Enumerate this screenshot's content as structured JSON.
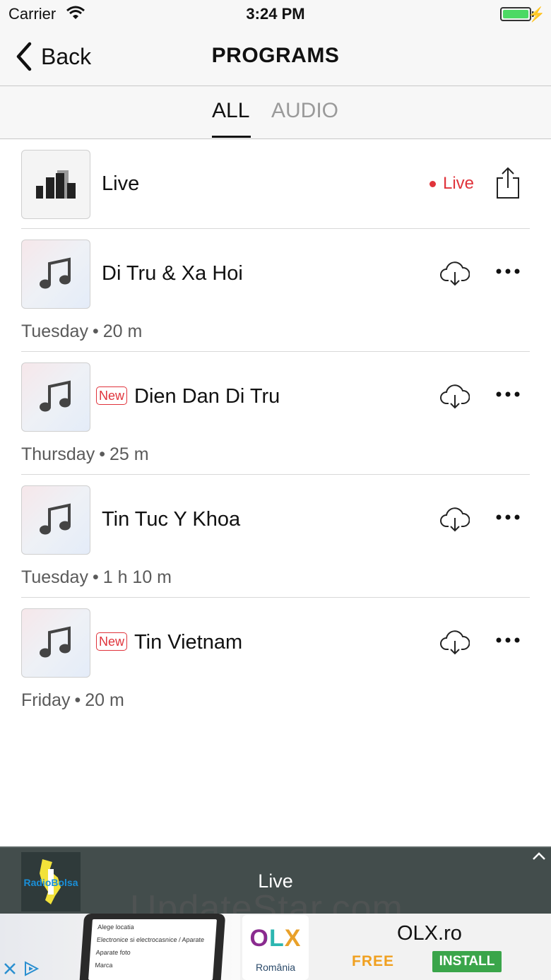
{
  "status_bar": {
    "carrier": "Carrier",
    "time": "3:24 PM"
  },
  "nav": {
    "back_label": "Back",
    "title": "PROGRAMS"
  },
  "tabs": [
    {
      "label": "ALL",
      "selected": true
    },
    {
      "label": "AUDIO",
      "selected": false
    }
  ],
  "live_row": {
    "title": "Live",
    "status": "Live"
  },
  "programs": [
    {
      "title": "Di Tru & Xa Hoi",
      "is_new": false,
      "day": "Tuesday",
      "duration": "20 m"
    },
    {
      "title": "Dien Dan Di Tru",
      "is_new": true,
      "new_label": "New",
      "day": "Thursday",
      "duration": "25 m"
    },
    {
      "title": "Tin Tuc Y Khoa",
      "is_new": false,
      "day": "Tuesday",
      "duration": "1 h 10 m"
    },
    {
      "title": "Tin Vietnam",
      "is_new": true,
      "new_label": "New",
      "day": "Friday",
      "duration": "20 m"
    }
  ],
  "meta_separator": "•",
  "player": {
    "title": "Live",
    "logo_text": "RadioBolsa"
  },
  "watermark": "UpdateStar.com",
  "ad": {
    "app_name": "OLX.ro",
    "logo_text": "OLX",
    "logo_sub": "România",
    "free_label": "FREE",
    "install_label": "INSTALL",
    "screen_lines": [
      "Alege locatia",
      "Electronice si electrocasnice / Aparate",
      "Aparate foto",
      "Marca"
    ]
  },
  "colors": {
    "accent_red": "#e0333b",
    "player_bg": "#434d4c",
    "install_green": "#3aa54a",
    "free_orange": "#f0a020"
  },
  "icons": {
    "back": "chevron-left-icon",
    "download": "cloud-download-icon",
    "more": "ellipsis-icon",
    "share": "share-icon",
    "music": "music-note-icon",
    "live": "bars-icon"
  }
}
